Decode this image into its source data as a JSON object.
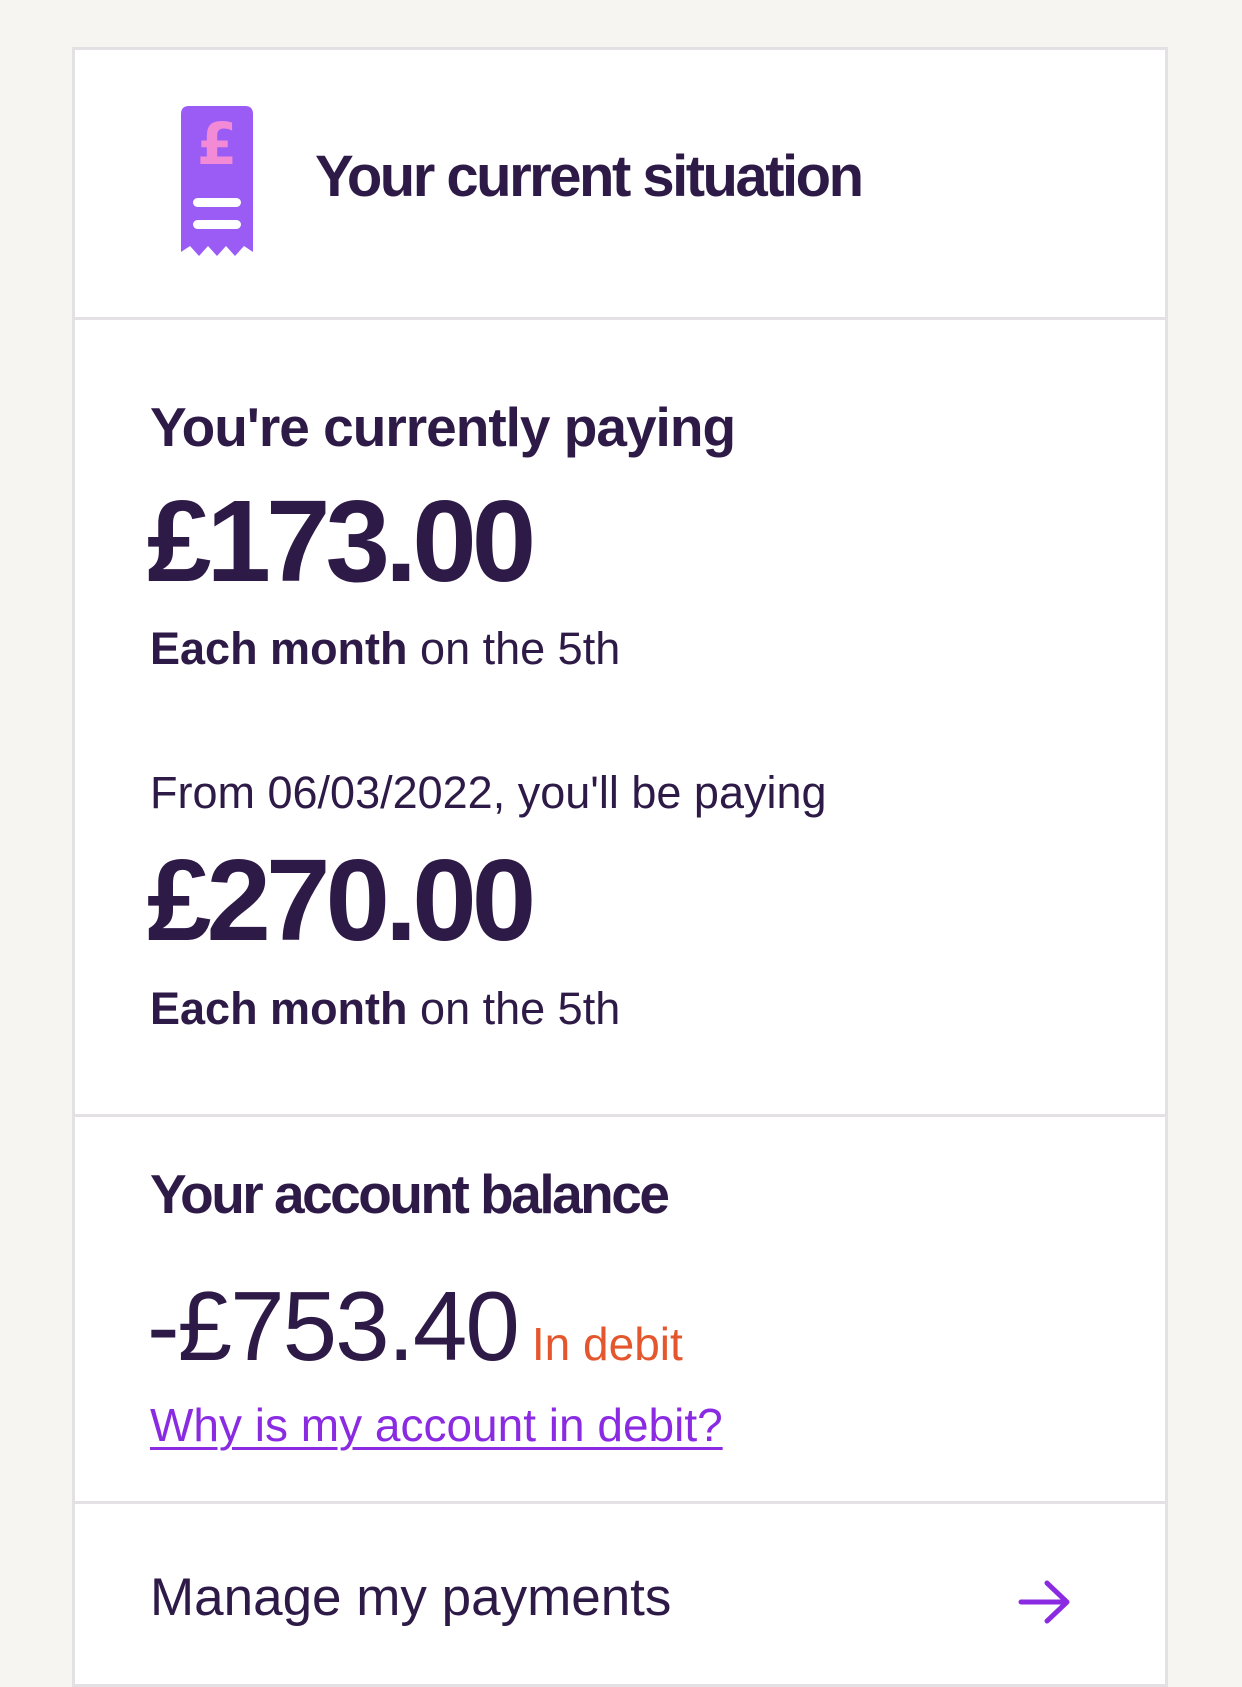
{
  "header": {
    "title": "Your current situation",
    "icon": "pound-receipt-icon"
  },
  "current_payment": {
    "lead": "You're currently paying",
    "amount": "£173.00",
    "frequency_bold": "Each month",
    "frequency_rest": "on the 5th"
  },
  "future_payment": {
    "lead": "From 06/03/2022, you'll be paying",
    "amount": "£270.00",
    "frequency_bold": "Each month",
    "frequency_rest": "on the 5th"
  },
  "balance": {
    "title": "Your account balance",
    "amount": "-£753.40",
    "status": "In debit",
    "help_link": "Why is my account in debit?"
  },
  "manage": {
    "label": "Manage my payments",
    "icon": "arrow-right-icon"
  },
  "colors": {
    "text": "#2e1a47",
    "accent": "#8a2be2",
    "icon_purple": "#9b5cf6",
    "icon_pink": "#f28ad6",
    "debit": "#e4572e",
    "background": "#f7f5f2",
    "border": "#e3e1e4"
  }
}
